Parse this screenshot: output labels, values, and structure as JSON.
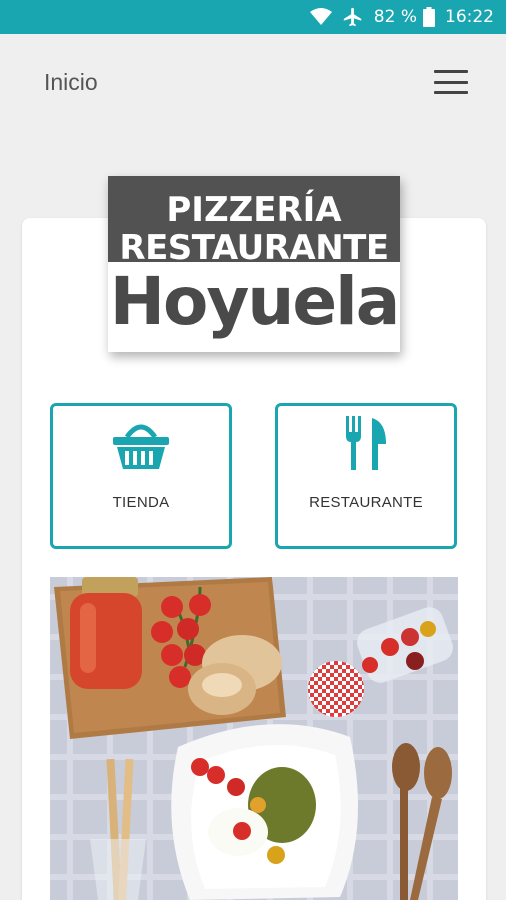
{
  "status_bar": {
    "battery_percent": "82 %",
    "time": "16:22",
    "icons": [
      "wifi-icon",
      "airplane-icon",
      "battery-icon"
    ]
  },
  "app_bar": {
    "title": "Inicio",
    "menu_icon": "hamburger-menu-icon"
  },
  "logo": {
    "line1": "PIZZERÍA",
    "line2": "RESTAURANTE",
    "line3": "Hoyuela"
  },
  "tiles": [
    {
      "label": "TIENDA",
      "icon": "shopping-basket-icon"
    },
    {
      "label": "RESTAURANTE",
      "icon": "fork-knife-icon"
    }
  ],
  "colors": {
    "accent": "#1aa6b1",
    "logo_band": "#525252",
    "background": "#efefef"
  }
}
